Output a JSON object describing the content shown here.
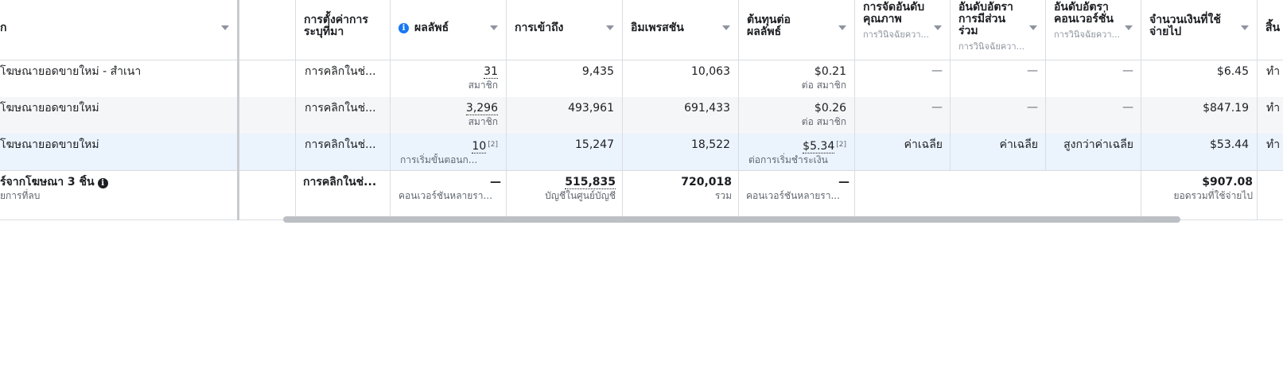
{
  "headers": {
    "name": "ก",
    "attribution": "การตั้งค่าการระบุที่มา",
    "results": "ผลลัพธ์",
    "reach": "การเข้าถึง",
    "impressions": "อิมเพรสชัน",
    "cost_per_result": "ต้นทุนต่อผลลัพธ์",
    "quality_ranking": "การจัดอันดับคุณภาพ",
    "quality_ranking_sub": "การวินิจฉัยควา...",
    "engagement_ranking": "อันดับอัตราการมีส่วนร่วม",
    "engagement_ranking_sub": "การวินิจฉัยควา...",
    "conversion_ranking": "อันดับอัตราคอนเวอร์ชั่น",
    "conversion_ranking_sub": "การวินิจฉัยควา...",
    "amount_spent": "จำนวนเงินที่ใช้จ่ายไป",
    "next_col": "สิ้น"
  },
  "rows": [
    {
      "name": "โฆษณายอดขายใหม่ - สำเนา",
      "attribution": "การคลิกในช่...",
      "results": "31",
      "results_sup": "",
      "results_sub": "สมาชิก",
      "reach": "9,435",
      "impressions": "10,063",
      "cost": "$0.21",
      "cost_sup": "",
      "cost_sub": "ต่อ สมาชิก",
      "quality": "—",
      "engagement": "—",
      "conversion": "—",
      "spent": "$6.45",
      "next": "ทำ"
    },
    {
      "name": "โฆษณายอดขายใหม่",
      "attribution": "การคลิกในช่...",
      "results": "3,296",
      "results_sup": "",
      "results_sub": "สมาชิก",
      "reach": "493,961",
      "impressions": "691,433",
      "cost": "$0.26",
      "cost_sup": "",
      "cost_sub": "ต่อ สมาชิก",
      "quality": "—",
      "engagement": "—",
      "conversion": "—",
      "spent": "$847.19",
      "next": "ทำ"
    },
    {
      "name": "โฆษณายอดขายใหม่",
      "attribution": "การคลิกในช่...",
      "results": "10",
      "results_sup": "[2]",
      "results_sub": "การเริ่มขั้นตอนก...",
      "reach": "15,247",
      "impressions": "18,522",
      "cost": "$5.34",
      "cost_sup": "[2]",
      "cost_sub": "ต่อการเริ่มชำระเงิน",
      "quality": "ค่าเฉลี่ย",
      "engagement": "ค่าเฉลี่ย",
      "conversion": "สูงกว่าค่าเฉลี่ย",
      "spent": "$53.44",
      "next": "ทำ"
    }
  ],
  "totals": {
    "name": "ร์จากโฆษณา 3 ชิ้น",
    "name_sub": "ยการที่ลบ",
    "attribution": "การคลิกในช่...",
    "results": "—",
    "results_sub": "คอนเวอร์ชันหลายรา...",
    "reach": "515,835",
    "reach_sub": "บัญชีในศูนย์บัญชี",
    "impressions": "720,018",
    "impressions_sub": "รวม",
    "cost": "—",
    "cost_sub": "คอนเวอร์ชันหลายรา...",
    "spent": "$907.08",
    "spent_sub": "ยอดรวมที่ใช้จ่ายไป"
  },
  "icons": {
    "info": "i"
  }
}
